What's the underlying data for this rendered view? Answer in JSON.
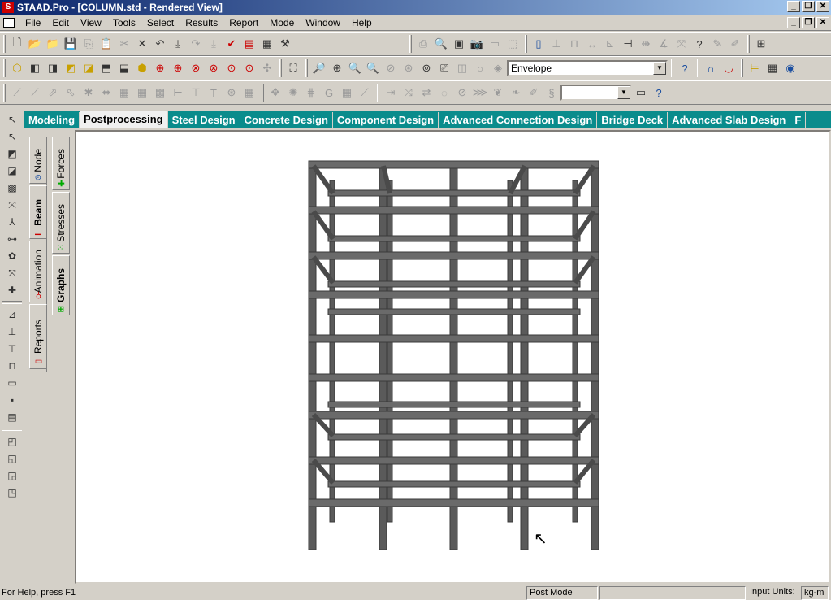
{
  "window": {
    "title": "STAAD.Pro - [COLUMN.std - Rendered View]"
  },
  "menu": {
    "items": [
      "File",
      "Edit",
      "View",
      "Tools",
      "Select",
      "Results",
      "Report",
      "Mode",
      "Window",
      "Help"
    ]
  },
  "toolbar": {
    "envelope_combo": "Envelope",
    "empty_combo": ""
  },
  "page_tabs": [
    "Modeling",
    "Postprocessing",
    "Steel Design",
    "Concrete Design",
    "Component Design",
    "Advanced Connection Design",
    "Bridge Deck",
    "Advanced Slab Design",
    "F"
  ],
  "active_page_tab": "Postprocessing",
  "side_tabs_left": [
    {
      "label": "Node",
      "icon": "node-icon"
    },
    {
      "label": "Beam",
      "icon": "beam-icon",
      "active": true
    },
    {
      "label": "Animation",
      "icon": "animation-icon"
    },
    {
      "label": "Reports",
      "icon": "reports-icon"
    }
  ],
  "side_tabs_right": [
    {
      "label": "Forces",
      "icon": "forces-icon"
    },
    {
      "label": "Stresses",
      "icon": "stresses-icon"
    },
    {
      "label": "Graphs",
      "icon": "graphs-icon",
      "active": true
    }
  ],
  "status": {
    "help": "For Help, press F1",
    "mode": "Post Mode",
    "blank": "",
    "input_units_label": "Input Units:",
    "input_units": "kg-m"
  },
  "colors": {
    "title_start": "#0a246a",
    "title_end": "#a6caf0",
    "tab_bar": "#0a8c8c",
    "beam": "#606060"
  }
}
